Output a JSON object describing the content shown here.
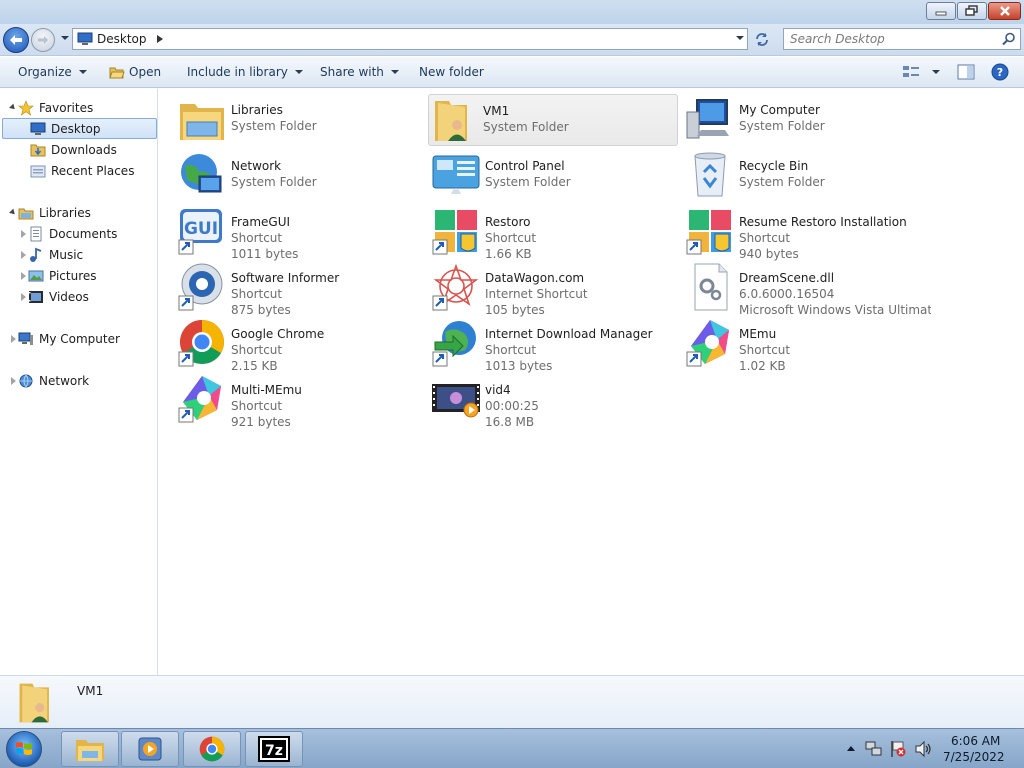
{
  "address": {
    "location": "Desktop"
  },
  "search": {
    "placeholder": "Search Desktop"
  },
  "toolbar": {
    "organize": "Organize",
    "open": "Open",
    "include_in_library": "Include in library",
    "share_with": "Share with",
    "new_folder": "New folder"
  },
  "nav": {
    "favorites": "Favorites",
    "desktop": "Desktop",
    "downloads": "Downloads",
    "recent_places": "Recent Places",
    "libraries": "Libraries",
    "documents": "Documents",
    "music": "Music",
    "pictures": "Pictures",
    "videos": "Videos",
    "my_computer": "My Computer",
    "network": "Network"
  },
  "items": [
    {
      "name": "Libraries",
      "line1": "System Folder",
      "line2": "",
      "icon": "libraries-icon"
    },
    {
      "name": "VM1",
      "line1": "System Folder",
      "line2": "",
      "icon": "user-folder-icon"
    },
    {
      "name": "My Computer",
      "line1": "System Folder",
      "line2": "",
      "icon": "computer-icon"
    },
    {
      "name": "Network",
      "line1": "System Folder",
      "line2": "",
      "icon": "network-icon"
    },
    {
      "name": "Control Panel",
      "line1": "System Folder",
      "line2": "",
      "icon": "control-panel-icon"
    },
    {
      "name": "Recycle Bin",
      "line1": "System Folder",
      "line2": "",
      "icon": "recycle-bin-icon"
    },
    {
      "name": "FrameGUI",
      "line1": "Shortcut",
      "line2": "1011 bytes",
      "icon": "gui-icon"
    },
    {
      "name": "Restoro",
      "line1": "Shortcut",
      "line2": "1.66 KB",
      "icon": "restoro-icon"
    },
    {
      "name": "Resume Restoro Installation",
      "line1": "Shortcut",
      "line2": "940 bytes",
      "icon": "restoro-icon"
    },
    {
      "name": "Software Informer",
      "line1": "Shortcut",
      "line2": "875 bytes",
      "icon": "software-informer-icon"
    },
    {
      "name": "DataWagon.com",
      "line1": "Internet Shortcut",
      "line2": "105 bytes",
      "icon": "datawagon-icon"
    },
    {
      "name": "DreamScene.dll",
      "line1": "6.0.6000.16504",
      "line2": "Microsoft Windows Vista Ultimat...",
      "icon": "dll-icon"
    },
    {
      "name": "Google Chrome",
      "line1": "Shortcut",
      "line2": "2.15 KB",
      "icon": "chrome-icon"
    },
    {
      "name": "Internet Download Manager",
      "line1": "Shortcut",
      "line2": "1013 bytes",
      "icon": "idm-icon"
    },
    {
      "name": "MEmu",
      "line1": "Shortcut",
      "line2": "1.02 KB",
      "icon": "memu-icon"
    },
    {
      "name": "Multi-MEmu",
      "line1": "Shortcut",
      "line2": "921 bytes",
      "icon": "memu-icon"
    },
    {
      "name": "vid4",
      "line1": "00:00:25",
      "line2": "16.8 MB",
      "icon": "video-icon"
    }
  ],
  "details": {
    "name": "VM1"
  },
  "clock": {
    "time": "6:06 AM",
    "date": "7/25/2022"
  },
  "colors": {
    "selection": "#cfe2f7",
    "accent": "#1c56b7"
  }
}
